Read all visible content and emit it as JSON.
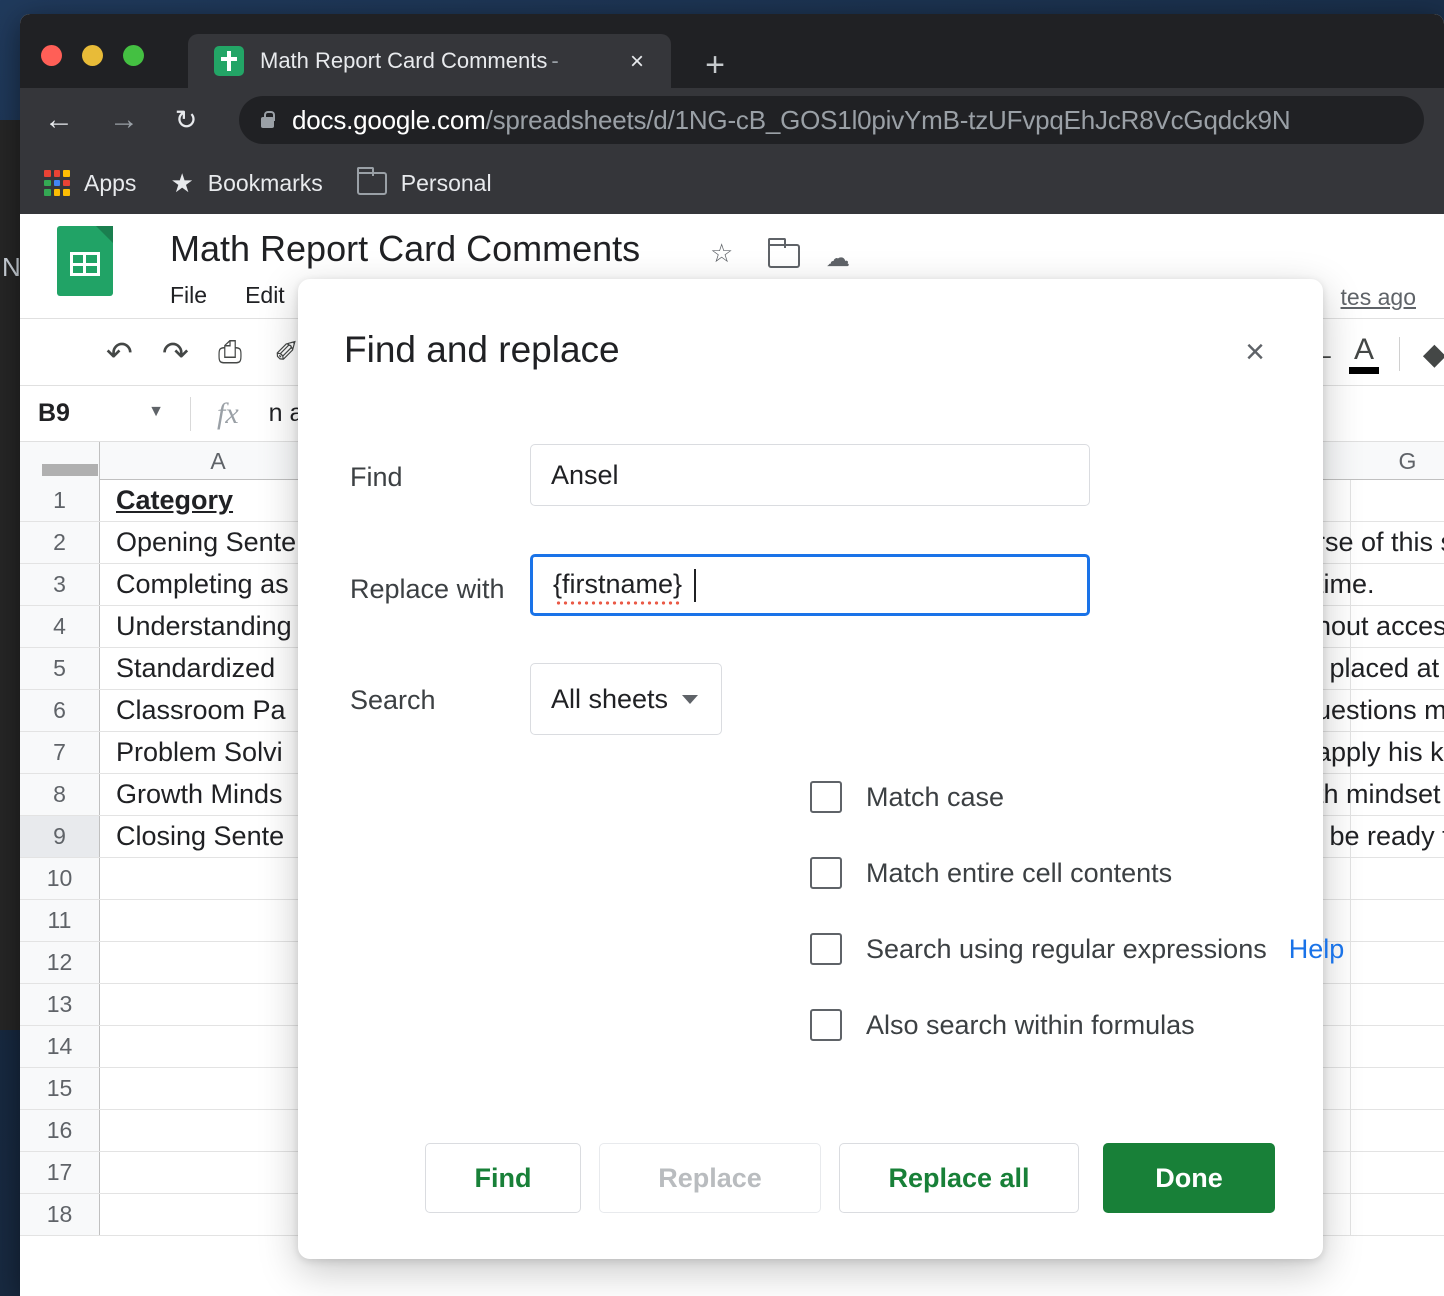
{
  "browser": {
    "tab": {
      "title": "Math Report Card Comments",
      "title_suffix": "-",
      "favicon": "google-sheets-favicon",
      "close_icon": "×",
      "new_tab_icon": "+"
    },
    "nav": {
      "back_icon": "←",
      "forward_icon": "→",
      "reload_icon": "↻"
    },
    "omnibox": {
      "lock_icon": "lock-icon",
      "host": "docs.google.com",
      "path": "/spreadsheets/d/1NG-cB_GOS1l0pivYmB-tzUFvpqEhJcR8VcGqdck9N"
    },
    "bookmarks": [
      {
        "label": "Apps",
        "icon": "apps-grid-icon"
      },
      {
        "label": "Bookmarks",
        "icon": "star-icon"
      },
      {
        "label": "Personal",
        "icon": "folder-icon"
      }
    ],
    "apps_grid_colors": [
      "#ea4335",
      "#ea4335",
      "#fbbc04",
      "#34a853",
      "#4285f4",
      "#ea4335",
      "#34a853",
      "#fbbc04",
      "#fbbc04"
    ]
  },
  "sheets": {
    "doc_title": "Math Report Card Comments",
    "star_icon": "☆",
    "folder_icon": "folder-icon",
    "cloud_icon": "☁",
    "menu": [
      "File",
      "Edit"
    ],
    "last_edit": "tes ago",
    "toolbar": {
      "undo_icon": "↶",
      "redo_icon": "↷",
      "print_icon": "⎙",
      "paint_icon": "✐",
      "strikethrough_icon": "S̶",
      "text_color_letter": "A",
      "fill_color_icon": "◆"
    },
    "formula_bar": {
      "cell_reference": "B9",
      "caret_icon": "▼",
      "fx_icon": "fx",
      "value": "n a pleasure"
    },
    "grid": {
      "column_headers": [
        "A",
        "G"
      ],
      "rows": [
        {
          "num": "1",
          "a": "Category",
          "right": "",
          "selected": false,
          "header": true
        },
        {
          "num": "2",
          "a": "Opening Sente",
          "right": "rse of this sc",
          "selected": false
        },
        {
          "num": "3",
          "a": "Completing as",
          "right": "time.",
          "selected": false
        },
        {
          "num": "4",
          "a": "Understanding",
          "right": "hout access",
          "selected": false
        },
        {
          "num": "5",
          "a": "Standardized ",
          "right": "l placed at a",
          "selected": false
        },
        {
          "num": "6",
          "a": "Classroom Pa",
          "right": "uestions mor",
          "selected": false
        },
        {
          "num": "7",
          "a": "Problem Solvi",
          "right": "apply his kn",
          "selected": false
        },
        {
          "num": "8",
          "a": "Growth Minds",
          "right": "th mindset a",
          "selected": false
        },
        {
          "num": "9",
          "a": "Closing Sente",
          "right": "l be ready to",
          "selected": true
        },
        {
          "num": "10",
          "a": "",
          "right": "",
          "selected": false
        },
        {
          "num": "11",
          "a": "",
          "right": "",
          "selected": false
        },
        {
          "num": "12",
          "a": "",
          "right": "",
          "selected": false
        },
        {
          "num": "13",
          "a": "",
          "right": "",
          "selected": false
        },
        {
          "num": "14",
          "a": "",
          "right": "",
          "selected": false
        },
        {
          "num": "15",
          "a": "",
          "right": "",
          "selected": false
        },
        {
          "num": "16",
          "a": "",
          "right": "",
          "selected": false
        },
        {
          "num": "17",
          "a": "",
          "right": "",
          "selected": false
        },
        {
          "num": "18",
          "a": "",
          "right": "",
          "selected": false
        }
      ]
    }
  },
  "dialog": {
    "title": "Find and replace",
    "close_icon": "×",
    "find": {
      "label": "Find",
      "value": "Ansel"
    },
    "replace": {
      "label": "Replace with",
      "value": "{firstname}",
      "focused": true,
      "spellcheck_underline": true
    },
    "search": {
      "label": "Search",
      "selected_option": "All sheets",
      "caret_icon": "▼"
    },
    "options": [
      {
        "label": "Match case",
        "checked": false
      },
      {
        "label": "Match entire cell contents",
        "checked": false
      },
      {
        "label": "Search using regular expressions",
        "checked": false,
        "help_link": "Help"
      },
      {
        "label": "Also search within formulas",
        "checked": false
      }
    ],
    "buttons": {
      "find": "Find",
      "replace": "Replace",
      "replace_all": "Replace all",
      "done": "Done"
    }
  },
  "colors": {
    "accent_blue": "#1a73e8",
    "sheets_green": "#188038",
    "spellcheck_red": "#ea5a47"
  }
}
